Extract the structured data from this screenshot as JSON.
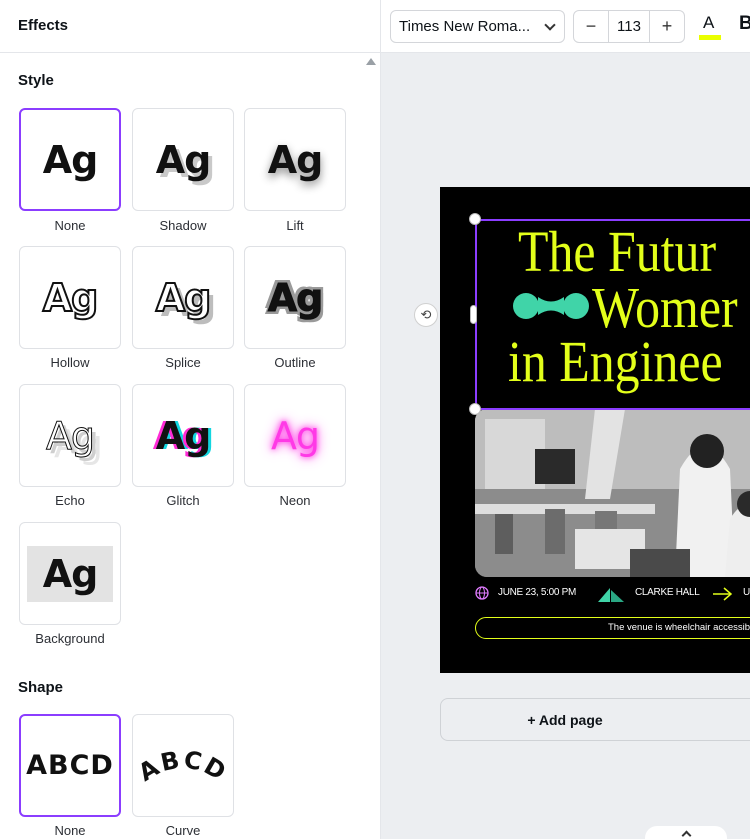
{
  "effects_panel": {
    "title": "Effects",
    "style_section": {
      "title": "Style",
      "options": [
        {
          "label": "None",
          "selected": true
        },
        {
          "label": "Shadow",
          "selected": false
        },
        {
          "label": "Lift",
          "selected": false
        },
        {
          "label": "Hollow",
          "selected": false
        },
        {
          "label": "Splice",
          "selected": false
        },
        {
          "label": "Outline",
          "selected": false
        },
        {
          "label": "Echo",
          "selected": false
        },
        {
          "label": "Glitch",
          "selected": false
        },
        {
          "label": "Neon",
          "selected": false
        },
        {
          "label": "Background",
          "selected": false
        }
      ],
      "preview_text": "Ag"
    },
    "shape_section": {
      "title": "Shape",
      "options": [
        {
          "label": "None",
          "selected": true
        },
        {
          "label": "Curve",
          "selected": false
        }
      ],
      "preview_text": "ABCD"
    }
  },
  "toolbar": {
    "font_family": "Times New Roma...",
    "font_size": "113",
    "decrease_label": "−",
    "increase_label": "+",
    "text_color_glyph": "A",
    "text_color": "#eaff00",
    "bold_label": "B"
  },
  "design": {
    "title_lines": [
      "The Futur",
      "Womer",
      "in Enginee"
    ],
    "title_color": "#e3ff1a",
    "accent_color": "#40d4a8",
    "date": "JUNE 23, 5:00 PM",
    "location": "CLARKE HALL",
    "extra": "U",
    "venue_note": "The venue is wheelchair accessible"
  },
  "canvas": {
    "add_page_label": "+ Add page",
    "selection_color": "#8b3dff"
  }
}
